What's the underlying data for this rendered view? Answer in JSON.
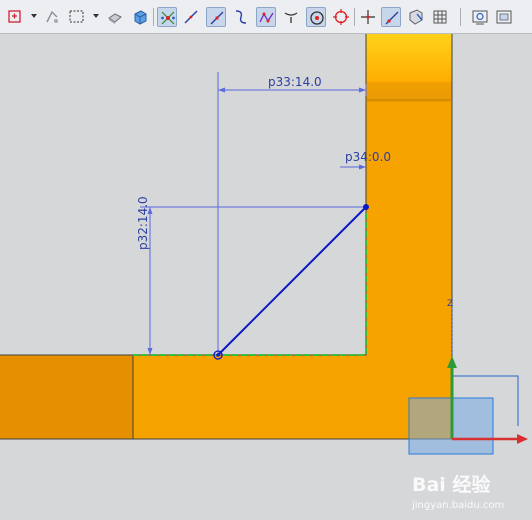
{
  "toolbar": {
    "icons": [
      {
        "name": "sketch-profile-icon",
        "active": false
      },
      {
        "name": "quick-trim-icon",
        "active": false
      },
      {
        "name": "selection-box-icon",
        "active": false
      },
      {
        "name": "render-style-icon",
        "active": false
      },
      {
        "name": "solid-view-icon",
        "active": false
      },
      {
        "name": "inferred-constraints-icon",
        "active": true
      },
      {
        "name": "line-icon",
        "active": false
      },
      {
        "name": "line-tangent-icon",
        "active": true
      },
      {
        "name": "curve-icon",
        "active": false
      },
      {
        "name": "studio-spline-icon",
        "active": true
      },
      {
        "name": "fillet-icon",
        "active": false
      },
      {
        "name": "point-on-curve-icon",
        "active": true
      },
      {
        "name": "circle-center-icon",
        "active": false
      },
      {
        "name": "crosshair-point-icon",
        "active": false
      },
      {
        "name": "point-on-line-icon",
        "active": true
      },
      {
        "name": "orient-view-icon",
        "active": false
      },
      {
        "name": "grid-icon",
        "active": false
      },
      {
        "name": "fit-view-icon",
        "active": false
      },
      {
        "name": "frame-view-icon",
        "active": false
      }
    ]
  },
  "dimensions": {
    "p33": "p33:14.0",
    "p34": "p34:0.0",
    "p32": "p32:14.0"
  },
  "axis": {
    "z_label": "Z"
  },
  "watermark": {
    "logo": "Bai  经验",
    "url": "jingyan.baidu.com"
  },
  "colors": {
    "part": "#f6a300",
    "part_dark": "#e88f00",
    "dimension": "#2d3fa0",
    "sketch_line": "#0a18c8",
    "constraint": "#38c238"
  }
}
